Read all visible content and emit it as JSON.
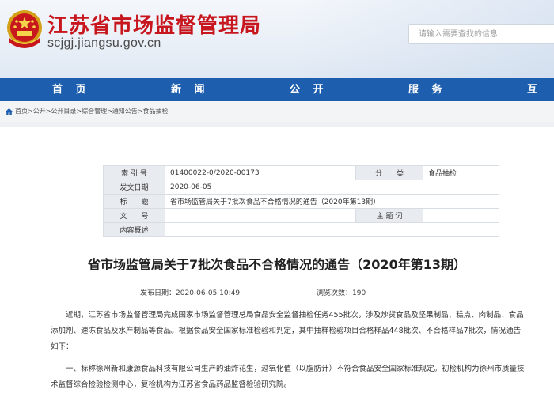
{
  "header": {
    "title": "江苏省市场监督管理局",
    "url": "scjgj.jiangsu.gov.cn",
    "search_placeholder": "请输入需要查找的信息",
    "emblem_icon": "national-emblem-icon"
  },
  "nav": {
    "items": [
      "首 页",
      "新 闻",
      "公 开",
      "服 务",
      "互 动"
    ]
  },
  "breadcrumb": {
    "icon": "home-icon",
    "text": "首页>公开>公开目录>综合管理>通知公告>食品抽检"
  },
  "meta": {
    "index_label": "索 引 号",
    "index_value": "01400022-0/2020-00173",
    "category_label": "分　　类",
    "category_value": "食品抽检",
    "date_label": "发文日期",
    "date_value": "2020-06-05",
    "title_label": "标　　题",
    "title_value": "省市场监管局关于7批次食品不合格情况的通告（2020年第13期）",
    "doc_label": "文　　号",
    "doc_value": "",
    "subject_label": "主 题 词",
    "subject_value": "",
    "summary_label": "内容概述",
    "summary_value": ""
  },
  "article": {
    "title": "省市场监管局关于7批次食品不合格情况的通告（2020年第13期）",
    "publish_label": "发布日期：",
    "publish_time": "2020-06-05 10:49",
    "views_label": "浏览次数：",
    "views": "190",
    "paragraphs": [
      "近期，江苏省市场监督管理局完成国家市场监督管理总局食品安全监督抽检任务455批次，涉及炒货食品及坚果制品、糕点、肉制品、食品添加剂、速冻食品及水产制品等食品。根据食品安全国家标准检验和判定，其中抽样检验项目合格样品448批次、不合格样品7批次，情况通告如下：",
      "一、标称徐州新和康源食品科技有限公司生产的油炸花生，过氧化值（以脂肪计）不符合食品安全国家标准规定。初检机构为徐州市质量技术监督综合检验检测中心，复检机构为江苏省食品药品监督检验研究院。"
    ]
  },
  "colors": {
    "title_red": "#c7161e",
    "nav_blue": "#1d5fae"
  }
}
